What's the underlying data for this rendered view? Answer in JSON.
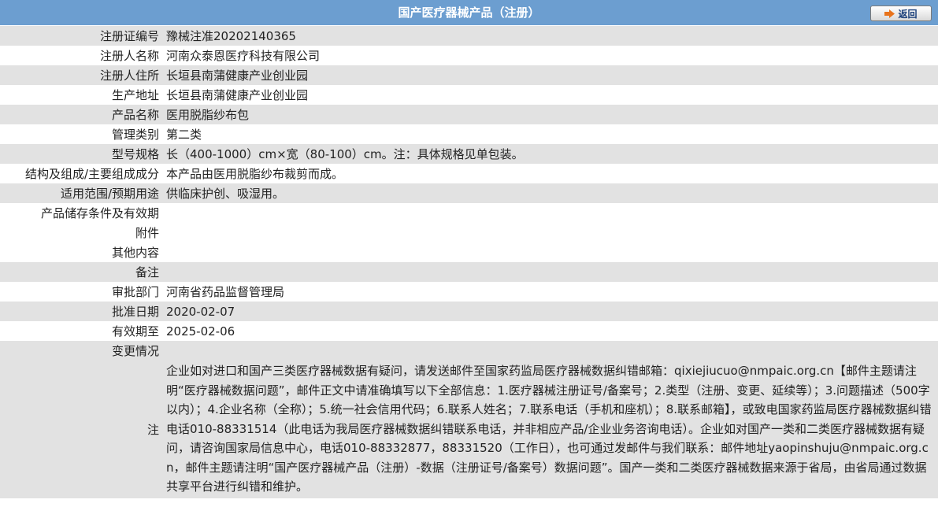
{
  "header": {
    "title": "国产医疗器械产品（注册）",
    "back_label": "返回",
    "back_icon": "arrow-right-icon"
  },
  "colors": {
    "header_bg": "#6c9ed0",
    "row_shade": "#e2e2e2",
    "arrow": "#e8731c"
  },
  "rows": [
    {
      "label": "注册证编号",
      "value": "豫械注准20202140365"
    },
    {
      "label": "注册人名称",
      "value": "河南众泰恩医疗科技有限公司"
    },
    {
      "label": "注册人住所",
      "value": "长垣县南蒲健康产业创业园"
    },
    {
      "label": "生产地址",
      "value": "长垣县南蒲健康产业创业园"
    },
    {
      "label": "产品名称",
      "value": "医用脱脂纱布包"
    },
    {
      "label": "管理类别",
      "value": "第二类"
    },
    {
      "label": "型号规格",
      "value": "长（400-1000）cm×宽（80-100）cm。注：具体规格见单包装。"
    },
    {
      "label": "结构及组成/主要组成成分",
      "value": "本产品由医用脱脂纱布裁剪而成。"
    },
    {
      "label": "适用范围/预期用途",
      "value": "供临床护创、吸湿用。"
    },
    {
      "label": "产品储存条件及有效期",
      "value": ""
    },
    {
      "label": "附件",
      "value": ""
    },
    {
      "label": "其他内容",
      "value": ""
    },
    {
      "label": "备注",
      "value": ""
    },
    {
      "label": "审批部门",
      "value": "河南省药品监督管理局"
    },
    {
      "label": "批准日期",
      "value": "2020-02-07"
    },
    {
      "label": "有效期至",
      "value": "2025-02-06"
    },
    {
      "label": "变更情况",
      "value": ""
    }
  ],
  "note": {
    "label": "注",
    "text": "企业如对进口和国产三类医疗器械数据有疑问，请发送邮件至国家药监局医疗器械数据纠错邮箱：qixiejiucuo@nmpaic.org.cn【邮件主题请注明“医疗器械数据问题”，邮件正文中请准确填写以下全部信息：1.医疗器械注册证号/备案号；2.类型（注册、变更、延续等）；3.问题描述（500字以内）；4.企业名称（全称）；5.统一社会信用代码；6.联系人姓名；7.联系电话（手机和座机）；8.联系邮箱】，或致电国家药监局医疗器械数据纠错电话010-88331514（此电话为我局医疗器械数据纠错联系电话，并非相应产品/企业业务咨询电话）。企业如对国产一类和二类医疗器械数据有疑问，请咨询国家局信息中心，电话010-88332877，88331520（工作日），也可通过发邮件与我们联系：邮件地址yaopinshuju@nmpaic.org.cn，邮件主题请注明“国产医疗器械产品（注册）-数据（注册证号/备案号）数据问题”。国产一类和二类医疗器械数据来源于省局，由省局通过数据共享平台进行纠错和维护。"
  }
}
